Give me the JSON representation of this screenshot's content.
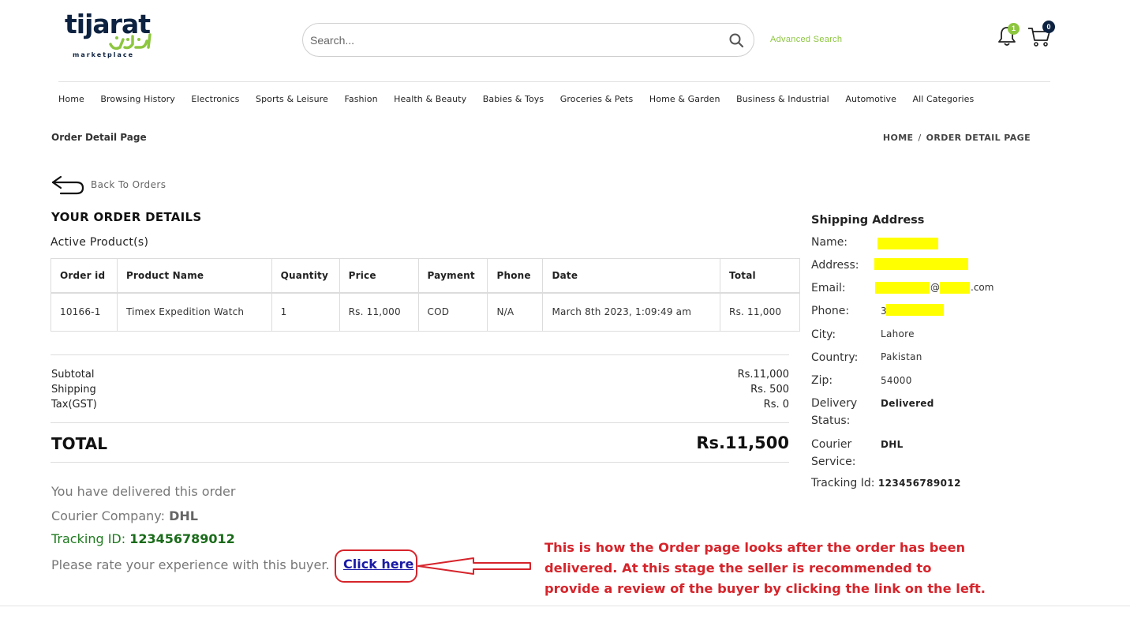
{
  "brand": {
    "logo_text": "tijarat",
    "logo_sub": "marketplace",
    "primary_color": "#0d2240",
    "accent_color": "#8dc63f"
  },
  "header": {
    "search_placeholder": "Search...",
    "advanced_search": "Advanced Search",
    "notification_count": "1",
    "cart_count": "0"
  },
  "nav": {
    "items": [
      "Home",
      "Browsing History",
      "Electronics",
      "Sports & Leisure",
      "Fashion",
      "Health & Beauty",
      "Babies & Toys",
      "Groceries & Pets",
      "Home & Garden",
      "Business & Industrial",
      "Automotive",
      "All Categories"
    ]
  },
  "page": {
    "title": "Order Detail Page",
    "breadcrumb_home": "HOME",
    "breadcrumb_sep": "/",
    "breadcrumb_current": "ORDER DETAIL PAGE",
    "back_label": "Back To Orders"
  },
  "order": {
    "heading": "YOUR ORDER DETAILS",
    "subheading": "Active Product(s)",
    "columns": [
      "Order id",
      "Product Name",
      "Quantity",
      "Price",
      "Payment",
      "Phone",
      "Date",
      "Total"
    ],
    "rows": [
      [
        "10166-1",
        "Timex Expedition Watch",
        "1",
        "Rs. 11,000",
        "COD",
        "N/A",
        "March 8th 2023, 1:09:49 am",
        "Rs. 11,000"
      ]
    ],
    "summary": {
      "subtotal_label": "Subtotal",
      "subtotal_value": "Rs.11,000",
      "shipping_label": "Shipping",
      "shipping_value": "Rs. 500",
      "tax_label": "Tax(GST)",
      "tax_value": "Rs. 0",
      "total_label": "TOTAL",
      "total_value": "Rs.11,500"
    },
    "status_message": "You have delivered this order",
    "courier_label": "Courier Company:",
    "courier_value": "DHL",
    "tracking_label": "Tracking ID:",
    "tracking_value": "123456789012",
    "rate_prompt": "Please rate your experience with this buyer.",
    "rate_link": "Click here"
  },
  "shipping": {
    "title": "Shipping Address",
    "name_label": "Name:",
    "address_label": "Address:",
    "email_label": "Email:",
    "email_at": "@",
    "email_domain_suffix": ".com",
    "phone_label": "Phone:",
    "phone_prefix": "3",
    "city_label": "City:",
    "city_value": "Lahore",
    "country_label": "Country:",
    "country_value": "Pakistan",
    "zip_label": "Zip:",
    "zip_value": "54000",
    "delivery_label_1": "Delivery",
    "delivery_label_2": "Status:",
    "delivery_value": "Delivered",
    "courier_label_1": "Courier",
    "courier_label_2": "Service:",
    "courier_value": "DHL",
    "tracking_label": "Tracking Id:",
    "tracking_value": "123456789012",
    "redaction_color": "#ffff00"
  },
  "annotation": {
    "text": "This is how the Order page looks after the order has been delivered. At this stage the seller is recommended to provide a review of the buyer by clicking the link on the left.",
    "color": "#d6242b"
  }
}
